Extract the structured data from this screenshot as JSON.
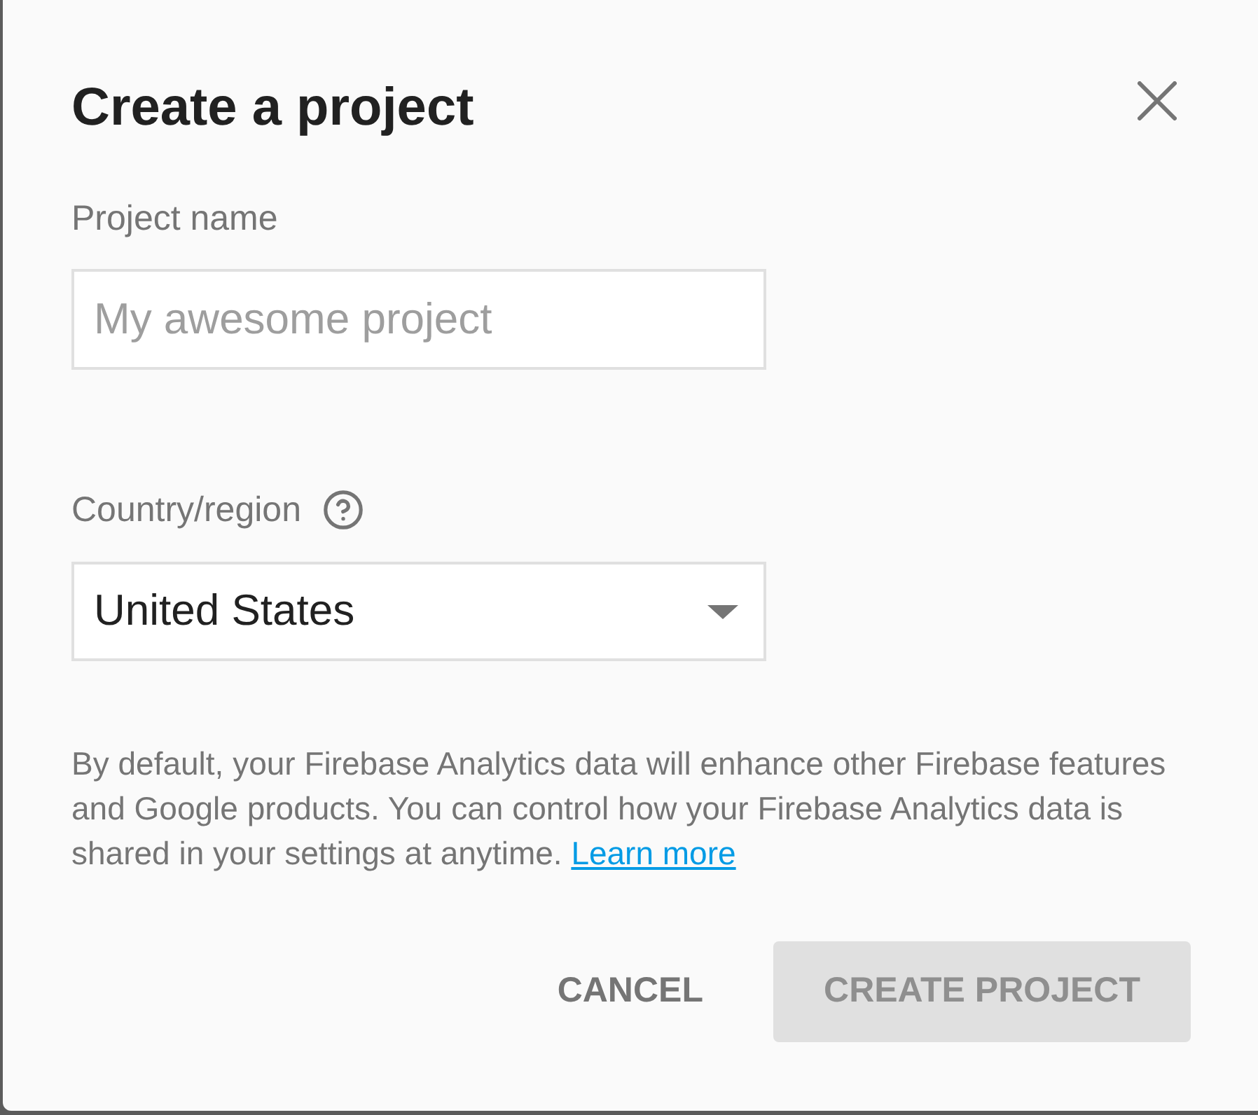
{
  "dialog": {
    "title": "Create a project"
  },
  "fields": [
    {
      "kind": "text",
      "label": "Project name",
      "placeholder": "My awesome project"
    },
    {
      "kind": "select",
      "label": "Country/region",
      "help": true,
      "value": "United States"
    }
  ],
  "notice": {
    "text": "By default, your Firebase Analytics data will enhance other Firebase features and Google products. You can control how your Firebase Analytics data is shared in your settings at anytime.",
    "link": "Learn more"
  },
  "buttons": [
    {
      "kind": "flat",
      "label": "CANCEL",
      "disabled": false
    },
    {
      "kind": "raised",
      "label": "CREATE PROJECT",
      "disabled": true
    }
  ]
}
